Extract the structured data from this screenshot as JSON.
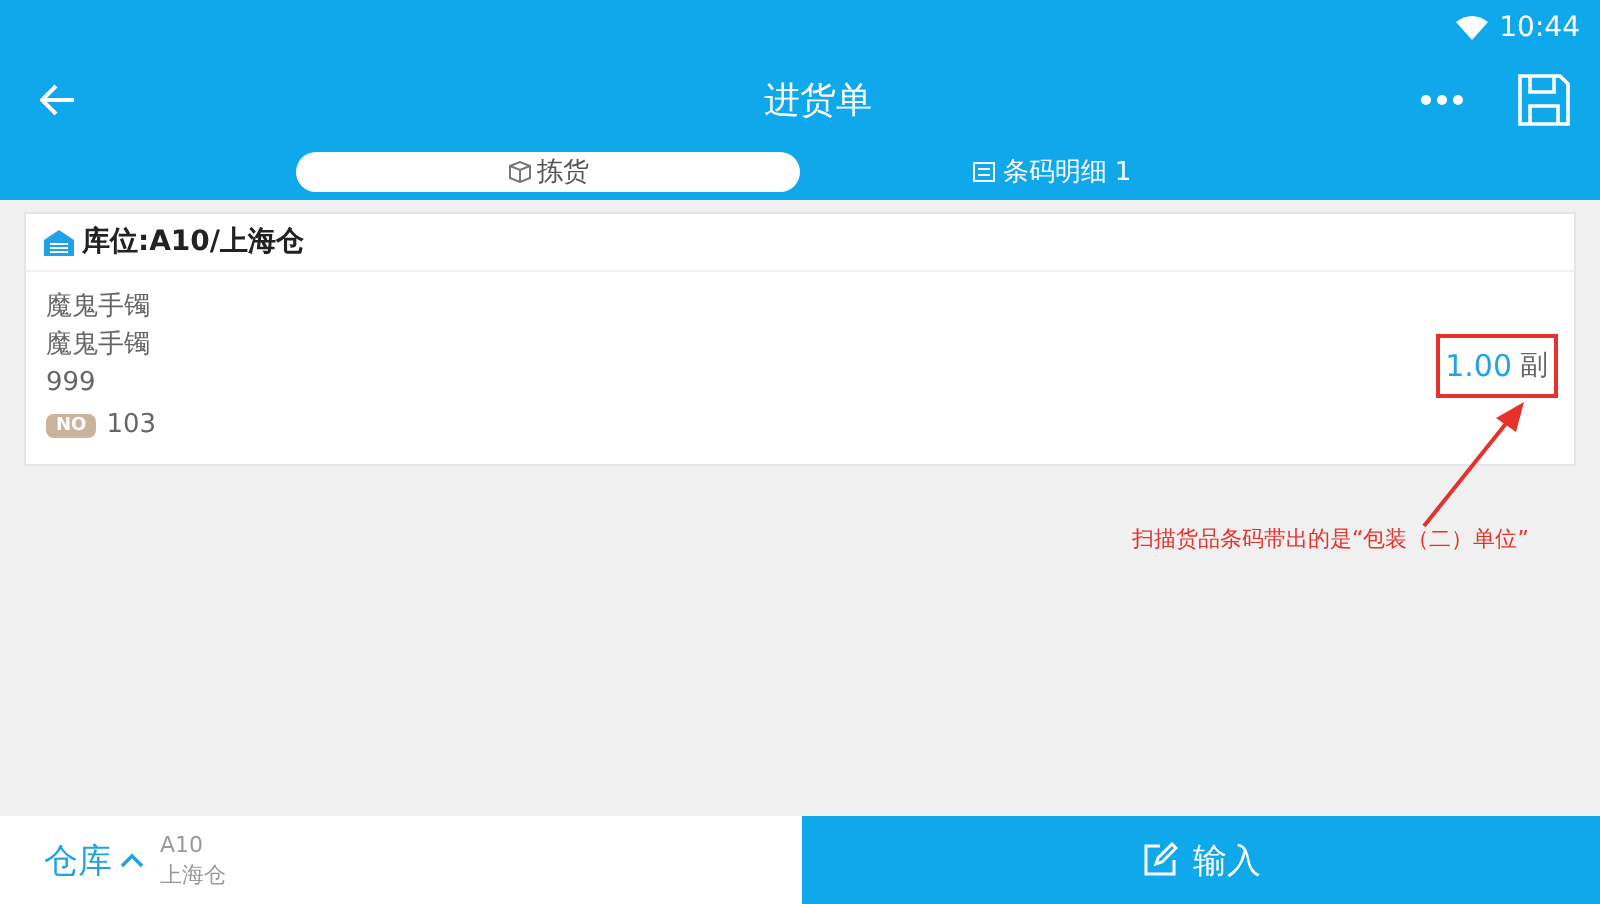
{
  "status_bar": {
    "time": "10:44"
  },
  "header": {
    "title": "进货单"
  },
  "tabs": [
    {
      "label": "拣货",
      "kind": "pick",
      "selected": true
    },
    {
      "label": "条码明细 1",
      "kind": "detail",
      "selected": false
    }
  ],
  "card": {
    "location": "库位:A10/上海仓",
    "lines": [
      "魔鬼手镯",
      "魔鬼手镯",
      "999"
    ],
    "badge": "NO",
    "number": "103",
    "quantity": "1.00",
    "unit": "副"
  },
  "annotation": {
    "text": "扫描货品条码带出的是“包装（二）单位”"
  },
  "bottom_bar": {
    "warehouse_label": "仓库",
    "code": "A10",
    "name": "上海仓",
    "input_button": "输入"
  }
}
